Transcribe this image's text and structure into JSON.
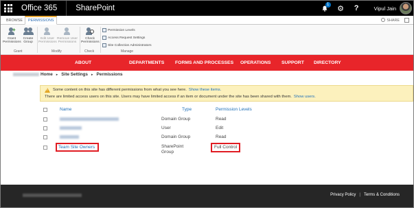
{
  "suite": {
    "app_name": "Office 365",
    "product_name": "SharePoint",
    "notification_count": "1",
    "settings_glyph": "⚙",
    "help_glyph": "?",
    "user_name": "Vipul Jain"
  },
  "ribbon_tabs": {
    "browse": "BROWSE",
    "permissions": "PERMISSIONS",
    "share": "SHARE"
  },
  "ribbon": {
    "grant_permissions": [
      "Grant",
      "Permissions"
    ],
    "create_group": [
      "Create",
      "Group"
    ],
    "edit_user_permissions": [
      "Edit User",
      "Permissions"
    ],
    "remove_user_permissions": [
      "Remove User",
      "Permissions"
    ],
    "check_permissions": [
      "Check",
      "Permissions"
    ],
    "permission_levels": "Permission Levels",
    "access_request_settings": "Access Request Settings",
    "site_collection_administrators": "Site Collection Administrators",
    "groups": {
      "grant": "Grant",
      "modify": "Modify",
      "check": "Check",
      "manage": "Manage"
    }
  },
  "nav": [
    "ABOUT",
    "DEPARTMENTS",
    "FORMS AND PROCESSES",
    "OPERATIONS",
    "SUPPORT",
    "DIRECTORY"
  ],
  "breadcrumb": {
    "home": "Home",
    "site_settings": "Site Settings",
    "permissions": "Permissions"
  },
  "message": {
    "line1": "Some content on this site has different permissions from what you see here.",
    "line1_link": "Show these items.",
    "line2": "There are limited access users on this site. Users may have limited access if an item or document under the site has been shared with them.",
    "line2_link": "Show users."
  },
  "table": {
    "headers": {
      "name": "Name",
      "type": "Type",
      "permission_levels": "Permission Levels"
    },
    "rows": [
      {
        "name": "",
        "type": "Domain Group",
        "level": "Read"
      },
      {
        "name": "",
        "type": "User",
        "level": "Edit"
      },
      {
        "name": "",
        "type": "Domain Group",
        "level": "Read"
      },
      {
        "name": "Team Site Owners",
        "type": "SharePoint Group",
        "type_lines": [
          "SharePoint",
          "Group"
        ],
        "level": "Full Control"
      }
    ]
  },
  "footer": {
    "privacy": "Privacy Policy",
    "separator": "|",
    "terms": "Terms & Conditions"
  },
  "colors": {
    "suite_bar": "#000000",
    "nav_bar": "#e8252a",
    "link": "#1e6fb8",
    "highlight": "#e01b22",
    "footer": "#262626",
    "message_bg": "#fcf1bd"
  }
}
